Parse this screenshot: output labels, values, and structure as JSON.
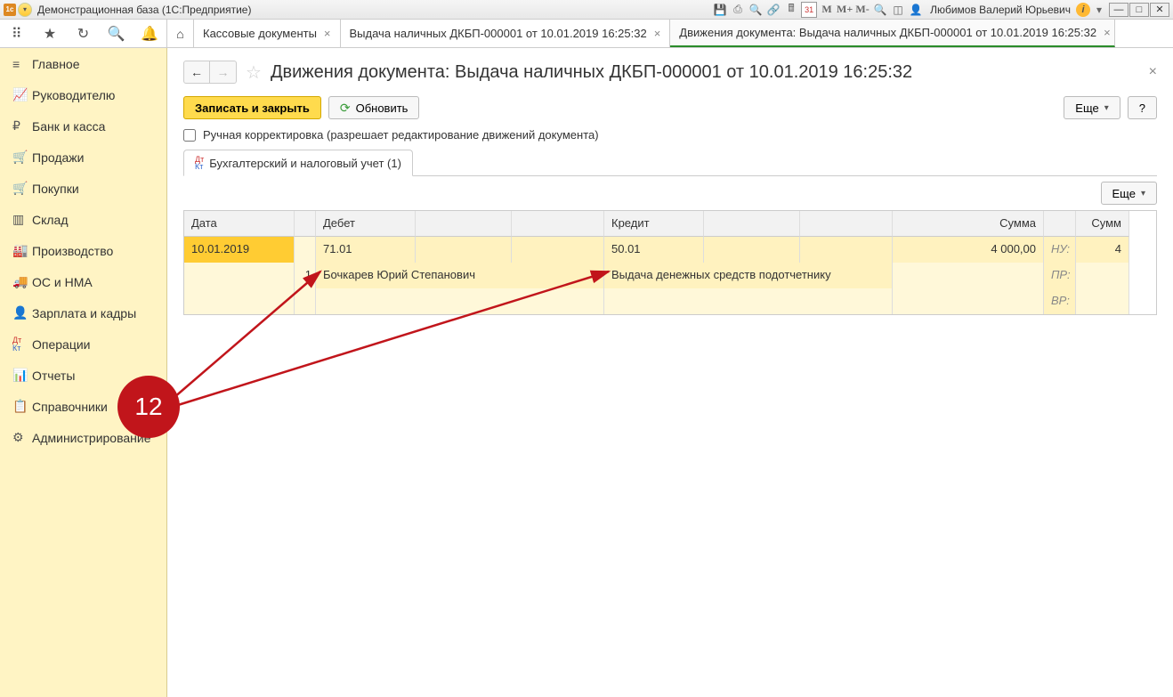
{
  "titlebar": {
    "title": "Демонстрационная база  (1С:Предприятие)",
    "calendar_day": "31",
    "user": "Любимов Валерий Юрьевич"
  },
  "tabs": [
    {
      "label": "Кассовые документы",
      "active": false
    },
    {
      "label": "Выдача наличных ДКБП-000001 от 10.01.2019 16:25:32",
      "active": false
    },
    {
      "label": "Движения документа: Выдача наличных ДКБП-000001 от 10.01.2019 16:25:32",
      "active": true
    }
  ],
  "sidebar": {
    "items": [
      {
        "icon": "≡",
        "label": "Главное"
      },
      {
        "icon": "↗",
        "label": "Руководителю"
      },
      {
        "icon": "₽",
        "label": "Банк и касса"
      },
      {
        "icon": "🛒",
        "label": "Продажи"
      },
      {
        "icon": "🛒",
        "label": "Покупки"
      },
      {
        "icon": "▥",
        "label": "Склад"
      },
      {
        "icon": "🏭",
        "label": "Производство"
      },
      {
        "icon": "🚚",
        "label": "ОС и НМА"
      },
      {
        "icon": "👤",
        "label": "Зарплата и кадры"
      },
      {
        "icon": "ᴰᴷ",
        "label": "Операции"
      },
      {
        "icon": "📊",
        "label": "Отчеты"
      },
      {
        "icon": "📋",
        "label": "Справочники"
      },
      {
        "icon": "⚙",
        "label": "Администрирование"
      }
    ]
  },
  "doc": {
    "title": "Движения документа: Выдача наличных ДКБП-000001 от 10.01.2019 16:25:32",
    "btn_save_close": "Записать и закрыть",
    "btn_refresh": "Обновить",
    "btn_more": "Еще",
    "btn_help": "?",
    "checkbox_label": "Ручная корректировка (разрешает редактирование движений документа)",
    "subtab_label": "Бухгалтерский и налоговый учет (1)"
  },
  "grid": {
    "headers": {
      "date": "Дата",
      "debit": "Дебет",
      "credit": "Кредит",
      "sum": "Сумма",
      "sum2": "Сумм"
    },
    "row": {
      "date": "10.01.2019",
      "n": "1",
      "debit_acc": "71.01",
      "debit_person": "Бочкарев Юрий Степанович",
      "credit_acc": "50.01",
      "credit_desc": "Выдача денежных средств подотчетнику",
      "sum": "4 000,00",
      "sum2_partial": "4",
      "nu": "НУ:",
      "pr": "ПР:",
      "vr": "ВР:"
    }
  },
  "annotation": {
    "marker": "12"
  }
}
